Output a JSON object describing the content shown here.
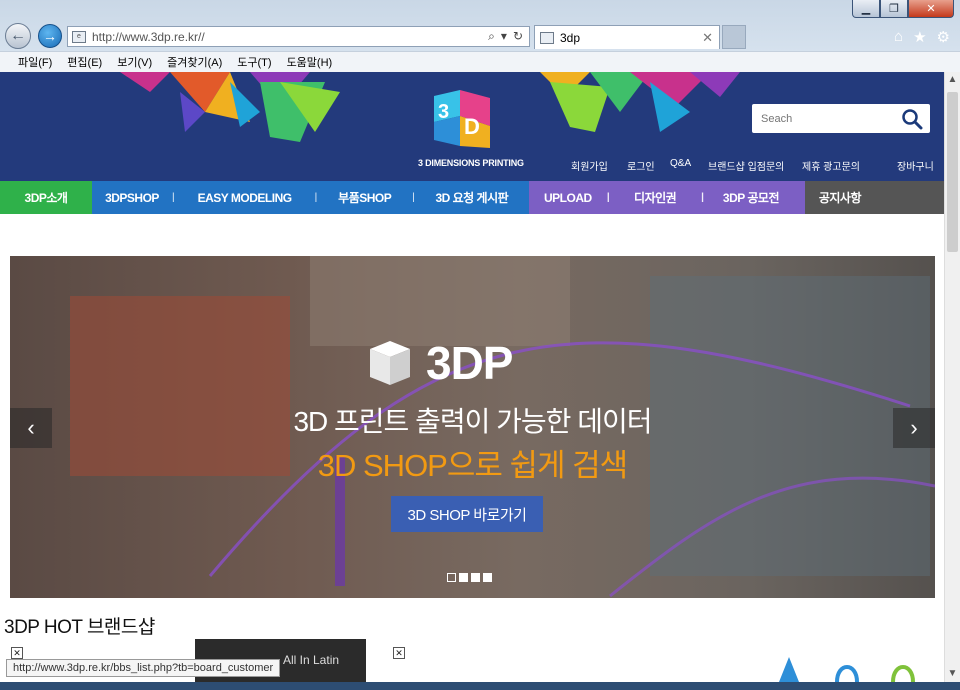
{
  "browser": {
    "url": "http://www.3dp.re.kr//",
    "tab_title": "3dp",
    "menu": [
      "파일(F)",
      "편집(E)",
      "보기(V)",
      "즐겨찾기(A)",
      "도구(T)",
      "도움말(H)"
    ],
    "status_url": "http://www.3dp.re.kr/bbs_list.php?tb=board_customer"
  },
  "header": {
    "logo_tagline": "3 DIMENSIONS PRINTING",
    "search_placeholder": "Seach",
    "util_links": [
      "회원가입",
      "로그인",
      "Q&A",
      "브랜드샵 입점문의",
      "제휴 광고문의",
      "장바구니"
    ]
  },
  "nav": [
    {
      "label": "3DP소개",
      "color": "#2fb14a"
    },
    {
      "label": "3DPSHOP",
      "color": "#2273c3"
    },
    {
      "label": "EASY MODELING",
      "color": "#2273c3"
    },
    {
      "label": "부품SHOP",
      "color": "#2273c3"
    },
    {
      "label": "3D 요청 게시판",
      "color": "#2273c3"
    },
    {
      "label": "UPLOAD",
      "color": "#7c5fc4"
    },
    {
      "label": "디자인권",
      "color": "#7c5fc4"
    },
    {
      "label": "3DP 공모전",
      "color": "#7c5fc4"
    },
    {
      "label": "공지사항",
      "color": "#555555"
    }
  ],
  "hero": {
    "brand": "3DP",
    "line1": "3D 프린트 출력이 가능한 데이터",
    "line2": "3D SHOP으로 쉽게 검색",
    "cta": "3D SHOP 바로가기",
    "slide_count": 4,
    "active_slide": 1
  },
  "section": {
    "title": "3DP HOT 브랜드샵",
    "thumb_text": "All In Latin"
  }
}
